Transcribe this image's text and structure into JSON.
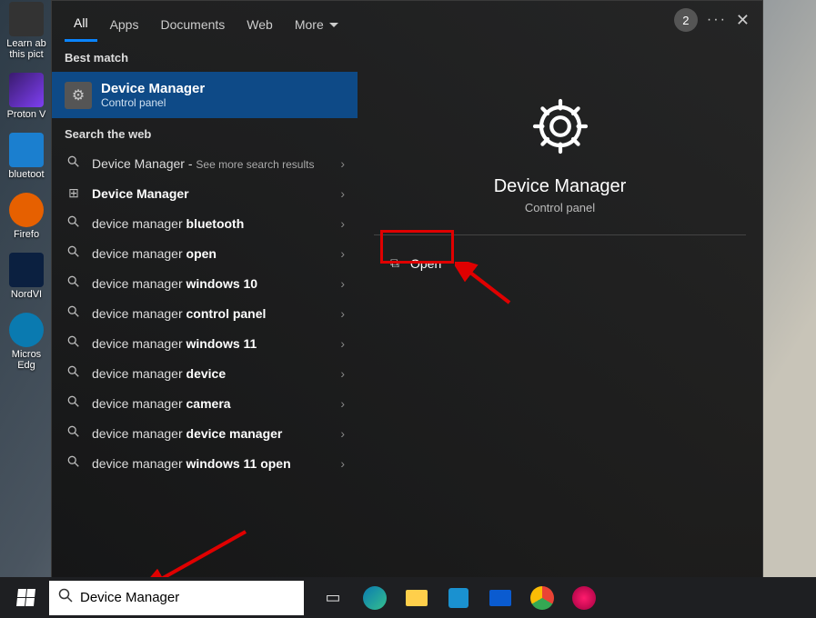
{
  "tabs": {
    "all": "All",
    "apps": "Apps",
    "documents": "Documents",
    "web": "Web",
    "more": "More"
  },
  "header": {
    "recent_count": "2"
  },
  "sections": {
    "best_match": "Best match",
    "search_web": "Search the web"
  },
  "best_match": {
    "title": "Device Manager",
    "subtitle": "Control panel"
  },
  "web_results": [
    {
      "prefix": "Device Manager",
      "bold": "",
      "suffix": " - ",
      "sub": "See more search results"
    },
    {
      "prefix": "",
      "bold": "Device Manager",
      "suffix": "",
      "icon": "settings"
    },
    {
      "prefix": "device manager ",
      "bold": "bluetooth",
      "suffix": ""
    },
    {
      "prefix": "device manager ",
      "bold": "open",
      "suffix": ""
    },
    {
      "prefix": "device manager ",
      "bold": "windows 10",
      "suffix": ""
    },
    {
      "prefix": "device manager ",
      "bold": "control panel",
      "suffix": ""
    },
    {
      "prefix": "device manager ",
      "bold": "windows 11",
      "suffix": ""
    },
    {
      "prefix": "device manager ",
      "bold": "device",
      "suffix": ""
    },
    {
      "prefix": "device manager ",
      "bold": "camera",
      "suffix": ""
    },
    {
      "prefix": "device manager ",
      "bold": "device manager",
      "suffix": ""
    },
    {
      "prefix": "device manager ",
      "bold": "windows 11 open",
      "suffix": ""
    }
  ],
  "preview": {
    "title": "Device Manager",
    "subtitle": "Control panel",
    "open_label": "Open"
  },
  "search": {
    "value": "Device Manager"
  },
  "desktop_icons": {
    "learn": "Learn ab",
    "learn2": "this pict",
    "proton": "Proton V",
    "bluetooth": "bluetoot",
    "firefox": "Firefo",
    "nord": "NordVI",
    "edge": "Micros",
    "edge2": "Edg"
  }
}
